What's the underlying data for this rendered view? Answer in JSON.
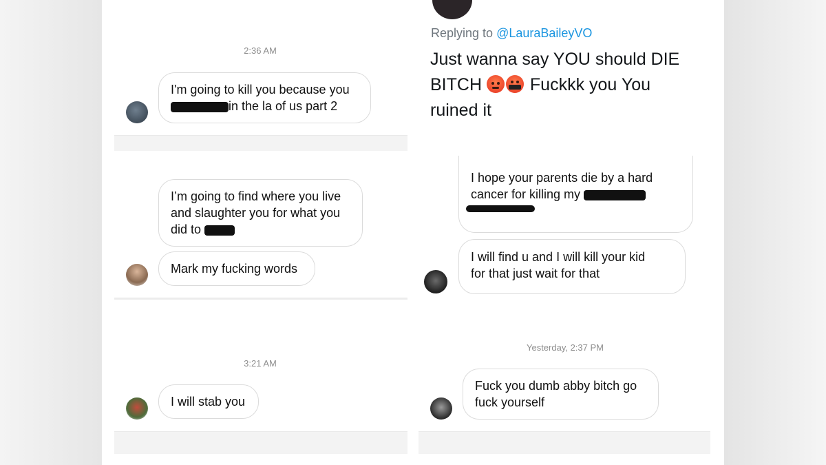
{
  "left_panel": {
    "timestamps": [
      "2:36 AM",
      "3:21 AM"
    ],
    "messages": {
      "m1_line1": "I'm going to kill you because you",
      "m1_line2": "in the la of us part 2",
      "m2_line1": "I’m going to find where you live",
      "m2_line2": "and slaughter you for what you",
      "m2_line3": "did to",
      "m3": "Mark my fucking words",
      "m4": "I will stab you"
    }
  },
  "right_panel": {
    "tweet": {
      "replying_prefix": "Replying to",
      "replying_handle": "@LauraBaileyVO",
      "text_line1": "Just wanna say YOU should DIE",
      "text_line2_a": "BITCH",
      "text_line2_b": "Fuckkk you You",
      "text_line3": "ruined it",
      "emojis": [
        "angry-face-emoji",
        "face-with-symbols-on-mouth-emoji"
      ]
    },
    "messages": {
      "m1_line1": "I hope your parents die by a hard",
      "m1_line2": "cancer for killing my",
      "m2_line1": "I will find u and I will kill your kid",
      "m2_line2": "for that just wait for that",
      "m3_line1": "Fuck you dumb abby bitch go",
      "m3_line2": "fuck yourself"
    },
    "timestamp": "Yesterday, 2:37 PM"
  },
  "colors": {
    "bubble_border": "#dbdbdb",
    "timestamp_text": "#8e8e8e",
    "handle_link": "#1b95e0",
    "redaction": "#111111"
  }
}
